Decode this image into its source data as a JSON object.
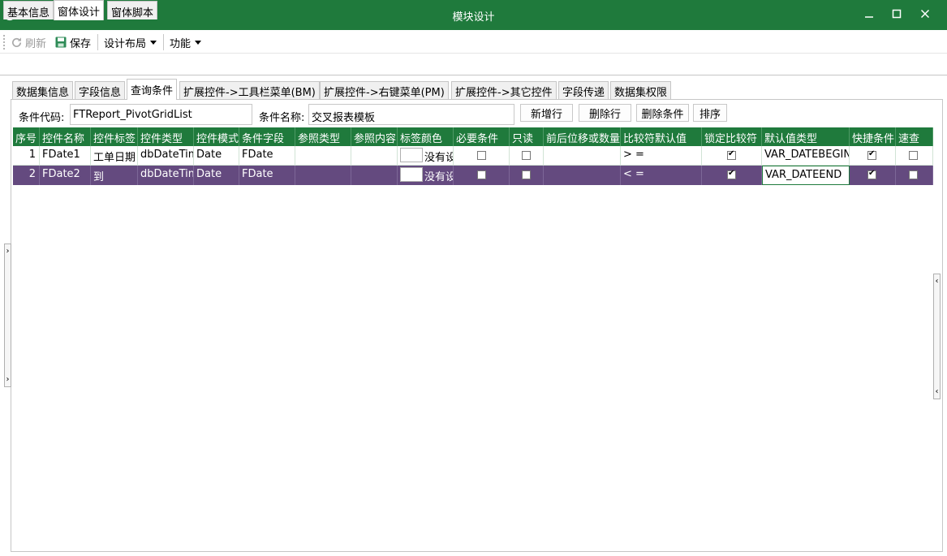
{
  "window": {
    "title": "模块设计"
  },
  "toolbar": {
    "refresh_label": "刷新",
    "save_label": "保存",
    "design_layout_label": "设计布局",
    "function_label": "功能"
  },
  "outer_tabs": [
    {
      "label": "基本信息"
    },
    {
      "label": "窗体设计"
    },
    {
      "label": "窗体脚本"
    }
  ],
  "inner_tabs": [
    {
      "label": "数据集信息"
    },
    {
      "label": "字段信息"
    },
    {
      "label": "查询条件"
    },
    {
      "label": "扩展控件->工具栏菜单(BM)"
    },
    {
      "label": "扩展控件->右键菜单(PM)"
    },
    {
      "label": "扩展控件->其它控件"
    },
    {
      "label": "字段传递"
    },
    {
      "label": "数据集权限"
    }
  ],
  "condition_form": {
    "code_label": "条件代码:",
    "code_value": "FTReport_PivotGridList",
    "name_label": "条件名称:",
    "name_value": "交叉报表模板",
    "add_row_label": "新增行",
    "delete_row_label": "删除行",
    "delete_condition_label": "删除条件",
    "sort_label": "排序"
  },
  "grid": {
    "columns": [
      "序号",
      "控件名称",
      "控件标签",
      "控件类型",
      "控件模式",
      "条件字段",
      "参照类型",
      "参照内容",
      "标签颜色",
      "必要条件",
      "只读",
      "前后位移或数量",
      "比较符默认值",
      "锁定比较符",
      "默认值类型",
      "快捷条件",
      "速查"
    ],
    "rows": [
      {
        "index": "1",
        "name": "FDate1",
        "label": "工单日期",
        "type": "dbDateTim",
        "mode": "Date",
        "field": "FDate",
        "ref_type": "",
        "ref_content": "",
        "color_text": "没有设",
        "required": false,
        "readonly": false,
        "offset": "",
        "operator": "> =",
        "lock_operator": true,
        "default_type": "VAR_DATEBEGIN",
        "quick": true,
        "lookup": false
      },
      {
        "index": "2",
        "name": "FDate2",
        "label": "到",
        "type": "dbDateTim",
        "mode": "Date",
        "field": "FDate",
        "ref_type": "",
        "ref_content": "",
        "color_text": "没有设",
        "required": false,
        "readonly": false,
        "offset": "",
        "operator": "< =",
        "lock_operator": true,
        "default_type": "VAR_DATEEND",
        "quick": true,
        "lookup": false
      }
    ]
  },
  "colors": {
    "title_bar": "#1f7a3c",
    "grid_header": "#1f7a3c",
    "selected_row": "#644a7f"
  },
  "icons": {
    "app": "globe-icon",
    "refresh": "refresh-icon",
    "save": "save-icon",
    "minimize": "minimize-icon",
    "maximize": "maximize-icon",
    "close": "close-icon"
  }
}
